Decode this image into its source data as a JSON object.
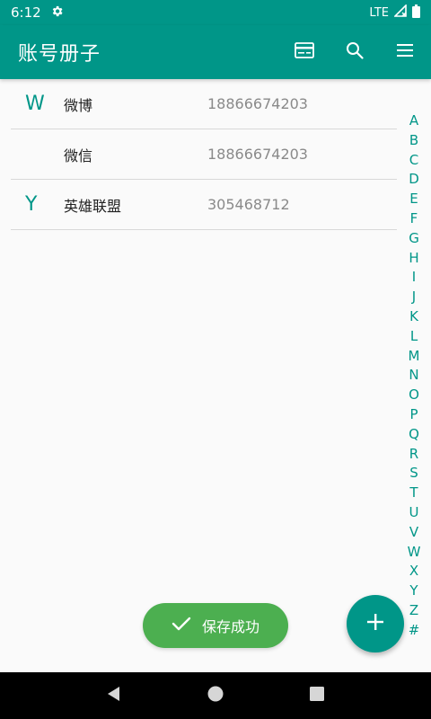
{
  "status_bar": {
    "time": "6:12",
    "network": "LTE",
    "icons": [
      "settings-icon",
      "signal-icon",
      "battery-icon"
    ]
  },
  "app_bar": {
    "title": "账号册子",
    "actions": [
      "card-icon",
      "search-icon",
      "menu-icon"
    ]
  },
  "accounts": [
    {
      "letter": "W",
      "name": "微博",
      "number": "18866674203"
    },
    {
      "letter": "",
      "name": "微信",
      "number": "18866674203"
    },
    {
      "letter": "Y",
      "name": "英雄联盟",
      "number": "305468712"
    }
  ],
  "alphabet_index": [
    "A",
    "B",
    "C",
    "D",
    "E",
    "F",
    "G",
    "H",
    "I",
    "J",
    "K",
    "L",
    "M",
    "N",
    "O",
    "P",
    "Q",
    "R",
    "S",
    "T",
    "U",
    "V",
    "W",
    "X",
    "Y",
    "Z",
    "#"
  ],
  "toast": {
    "text": "保存成功",
    "icon": "check-icon"
  },
  "fab": {
    "icon": "plus-icon"
  },
  "nav_bar": {
    "icons": [
      "back-icon",
      "home-icon",
      "recents-icon"
    ]
  },
  "colors": {
    "primary": "#009688",
    "toast_bg": "#4caf50",
    "text_primary": "#212121",
    "text_secondary": "#8a8a8a",
    "background": "#fafafa"
  }
}
